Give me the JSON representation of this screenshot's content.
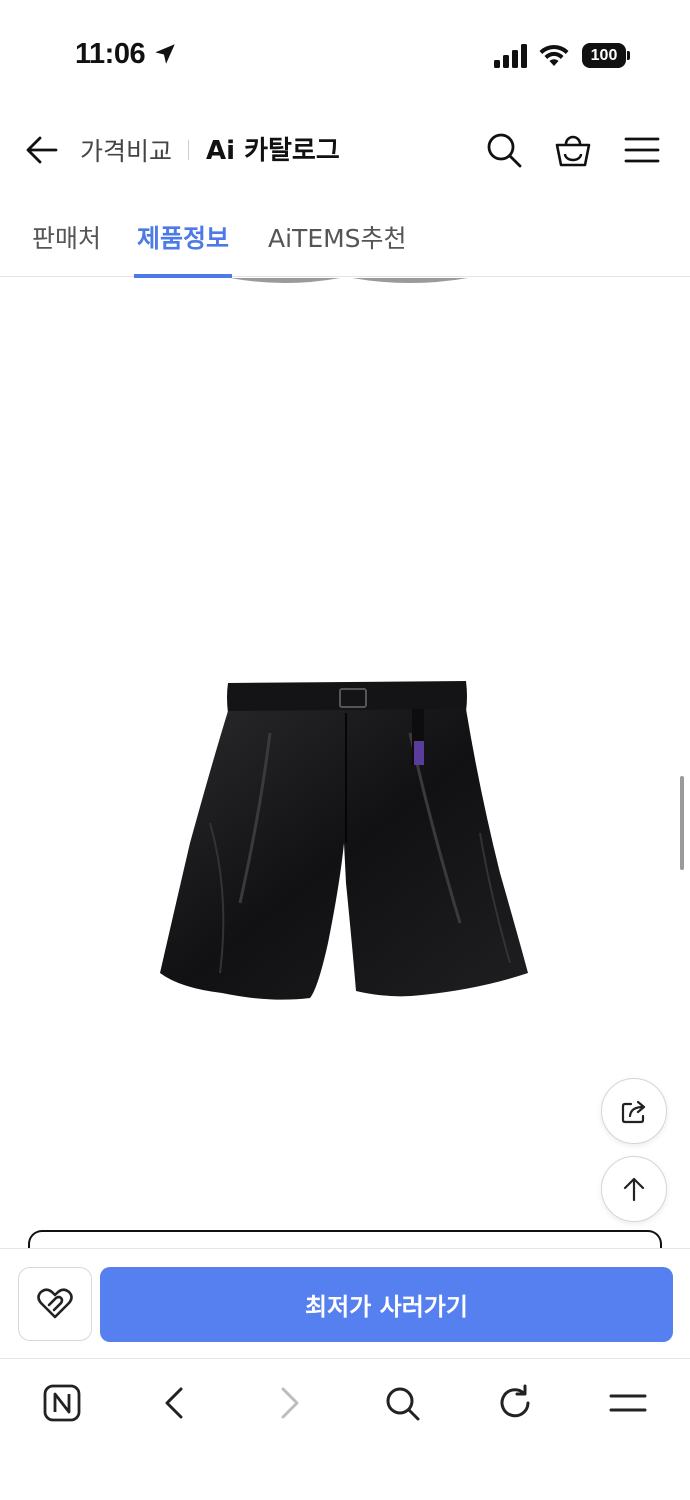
{
  "status_bar": {
    "time": "11:06",
    "battery": "100",
    "icons": [
      "location-arrow-icon",
      "signal-icon",
      "wifi-icon",
      "battery-icon"
    ]
  },
  "header": {
    "title": "가격비교",
    "catalog_label": "Ai 카탈로그",
    "icons": [
      "back-arrow-icon",
      "search-icon",
      "shopping-bag-icon",
      "menu-icon"
    ]
  },
  "tabs": [
    {
      "label": "판매처",
      "active": false
    },
    {
      "label": "제품정보",
      "active": true
    },
    {
      "label": "AiTEMS추천",
      "active": false
    }
  ],
  "accent_color": "#4e7ae8",
  "product": {
    "image": "black-nylon-shorts-image"
  },
  "floating_buttons": [
    "share-icon",
    "scroll-to-top-icon"
  ],
  "action_bar": {
    "wish_icon": "heart-icon",
    "buy_label": "최저가 사러가기",
    "buy_color": "#567ff0"
  },
  "browser_toolbar": {
    "items": [
      "naver-home-icon",
      "back-icon",
      "forward-icon",
      "search-icon",
      "refresh-icon",
      "menu-icon"
    ]
  }
}
